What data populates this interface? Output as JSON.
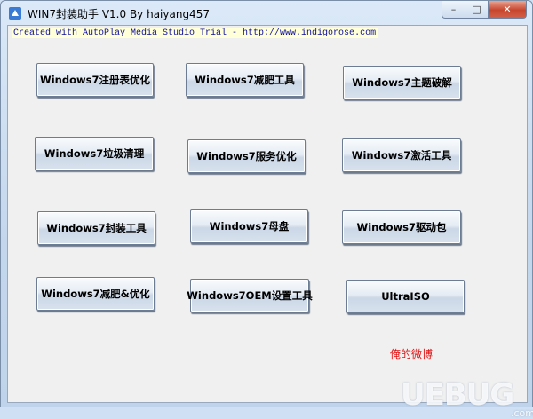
{
  "window": {
    "title": "WIN7封装助手 V1.0 By haiyang457",
    "minimize_glyph": "–",
    "maximize_glyph": "□",
    "close_glyph": "✕"
  },
  "trial_text": "Created with AutoPlay Media Studio Trial - http://www.indigorose.com",
  "buttons": [
    {
      "label": "Windows7注册表优化"
    },
    {
      "label": "Windows7减肥工具"
    },
    {
      "label": "Windows7主题破解"
    },
    {
      "label": "Windows7垃圾清理"
    },
    {
      "label": "Windows7服务优化"
    },
    {
      "label": "Windows7激活工具"
    },
    {
      "label": "Windows7封装工具"
    },
    {
      "label": "Windows7母盘"
    },
    {
      "label": "Windows7驱动包"
    },
    {
      "label": "Windows7减肥&优化"
    },
    {
      "label": "Windows7OEM设置工具"
    },
    {
      "label": "UltraISO"
    }
  ],
  "weibo_link": "俺的微博",
  "watermark": {
    "text": "UEBUG",
    "sub": ".com"
  }
}
